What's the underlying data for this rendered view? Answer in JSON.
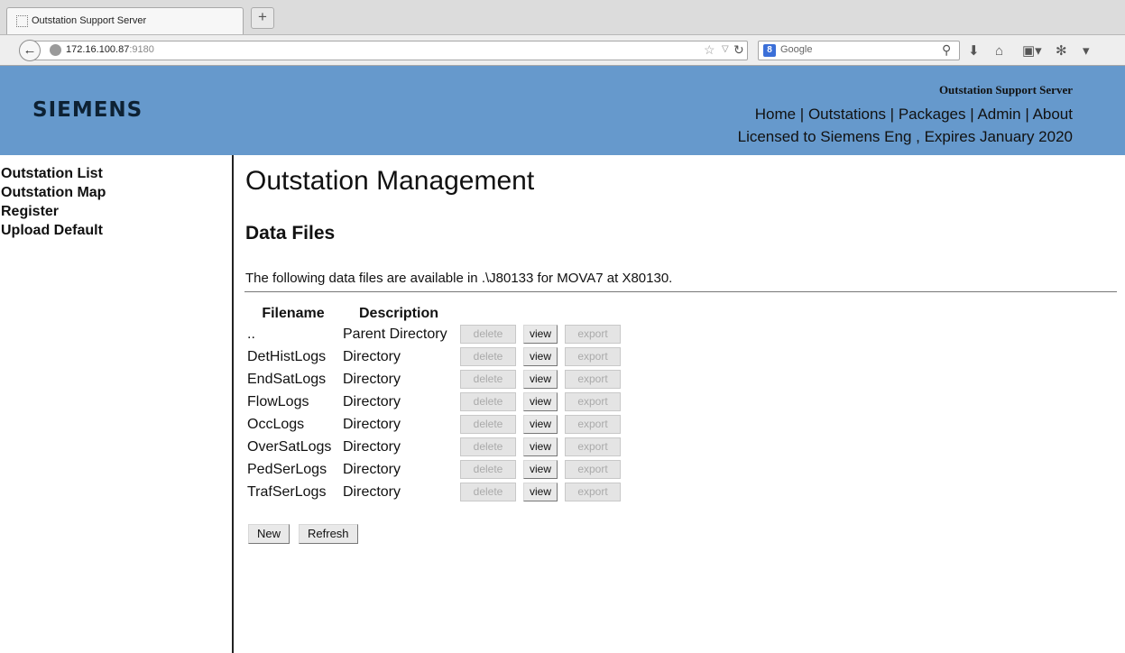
{
  "browser": {
    "tab_title": "Outstation Support Server",
    "new_tab_label": "+",
    "url_host": "172.16.100.87",
    "url_port": ":9180",
    "search_placeholder": "Google",
    "search_engine_letter": "8"
  },
  "header": {
    "logo": "SIEMENS",
    "server_title": "Outstation Support Server",
    "nav": [
      "Home",
      "Outstations",
      "Packages",
      "Admin",
      "About"
    ],
    "nav_separator": " | ",
    "license": "Licensed to Siemens Eng , Expires January 2020",
    "background_color": "#6699cc"
  },
  "sidebar": {
    "items": [
      "Outstation List",
      "Outstation Map",
      "Register",
      "Upload Default"
    ]
  },
  "main": {
    "title": "Outstation Management",
    "section_title": "Data Files",
    "intro": "The following data files are available in .\\J80133 for MOVA7 at X80130.",
    "columns": [
      "Filename",
      "Description"
    ],
    "button_labels": {
      "delete": "delete",
      "view": "view",
      "export": "export"
    },
    "rows": [
      {
        "name": "..",
        "description": "Parent Directory"
      },
      {
        "name": "DetHistLogs",
        "description": "Directory"
      },
      {
        "name": "EndSatLogs",
        "description": "Directory"
      },
      {
        "name": "FlowLogs",
        "description": "Directory"
      },
      {
        "name": "OccLogs",
        "description": "Directory"
      },
      {
        "name": "OverSatLogs",
        "description": "Directory"
      },
      {
        "name": "PedSerLogs",
        "description": "Directory"
      },
      {
        "name": "TrafSerLogs",
        "description": "Directory"
      }
    ],
    "actions": {
      "new_label": "New",
      "refresh_label": "Refresh"
    }
  }
}
